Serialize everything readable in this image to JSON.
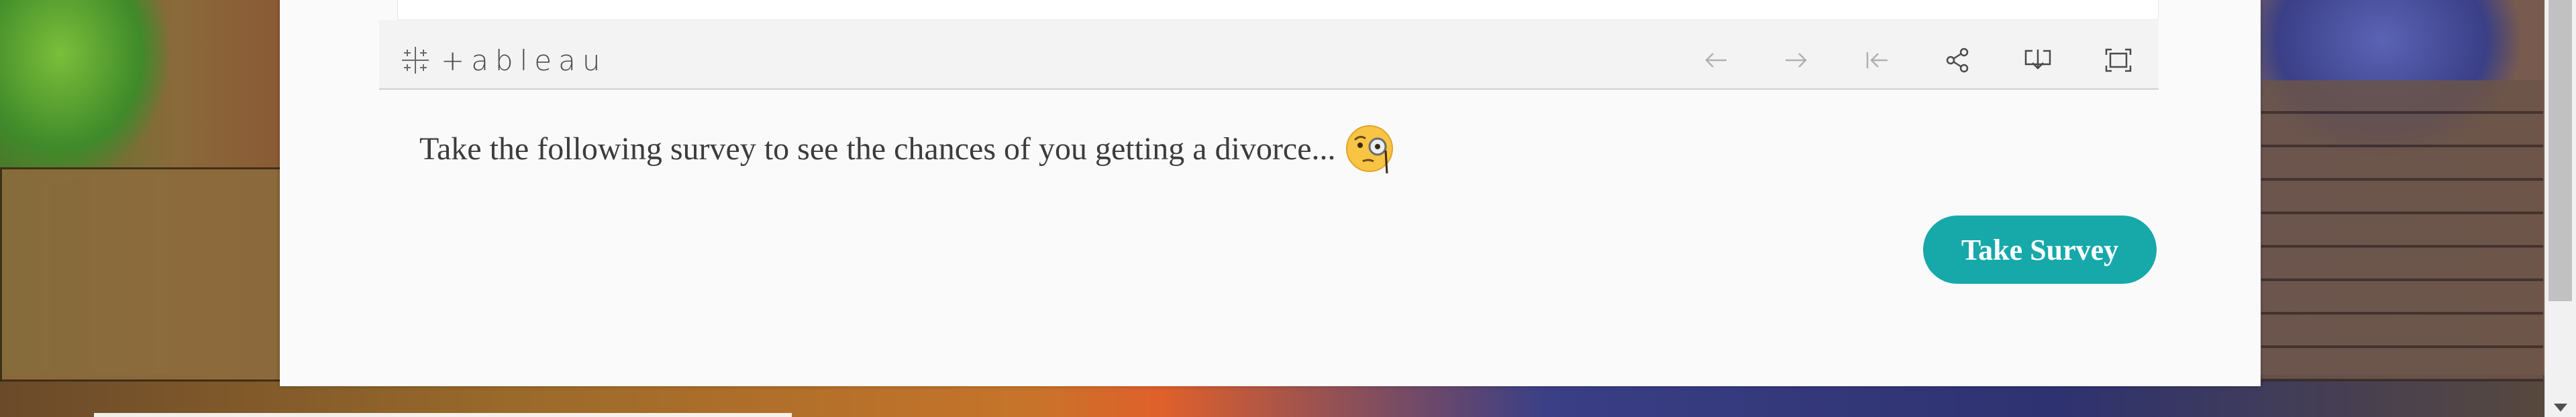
{
  "toolbar": {
    "brand": "+ableau",
    "icons": [
      {
        "name": "undo-arrow-icon",
        "enabled": false
      },
      {
        "name": "redo-arrow-icon",
        "enabled": false
      },
      {
        "name": "revert-to-start-icon",
        "enabled": false
      },
      {
        "name": "share-icon",
        "enabled": true
      },
      {
        "name": "download-icon",
        "enabled": true
      },
      {
        "name": "fullscreen-icon",
        "enabled": true
      }
    ]
  },
  "main": {
    "survey_prompt": "Take the following survey to see the chances of you getting a divorce...",
    "survey_button_label": "Take Survey"
  },
  "colors": {
    "button_teal": "#17a8aa",
    "card_background": "#fafafa",
    "toolbar_background": "#f3f3f3"
  }
}
